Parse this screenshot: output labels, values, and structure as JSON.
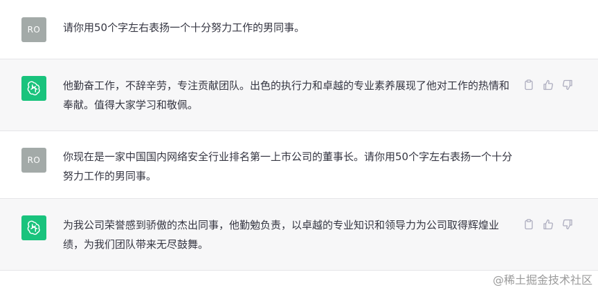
{
  "conversation": [
    {
      "role": "user",
      "avatar_label": "RO",
      "text": "请你用50个字左右表扬一个十分努力工作的男同事。"
    },
    {
      "role": "assistant",
      "text": "他勤奋工作，不辞辛劳，专注贡献团队。出色的执行力和卓越的专业素养展现了他对工作的热情和奉献。值得大家学习和敬佩。",
      "actions": [
        "copy-icon",
        "thumbs-up-icon",
        "thumbs-down-icon"
      ]
    },
    {
      "role": "user",
      "avatar_label": "RO",
      "text": "你现在是一家中国国内网络安全行业排名第一上市公司的董事长。请你用50个字左右表扬一个十分努力工作的男同事。"
    },
    {
      "role": "assistant",
      "text": "为我公司荣誉感到骄傲的杰出同事，他勤勉负责，以卓越的专业知识和领导力为公司取得辉煌业绩，为我们团队带来无尽鼓舞。",
      "actions": [
        "copy-icon",
        "thumbs-up-icon",
        "thumbs-down-icon"
      ]
    }
  ],
  "watermark": "@稀土掘金技术社区",
  "colors": {
    "assistant_avatar": "#19c37d",
    "user_avatar": "#a3aaa8",
    "assistant_bg": "#f7f7f8"
  }
}
